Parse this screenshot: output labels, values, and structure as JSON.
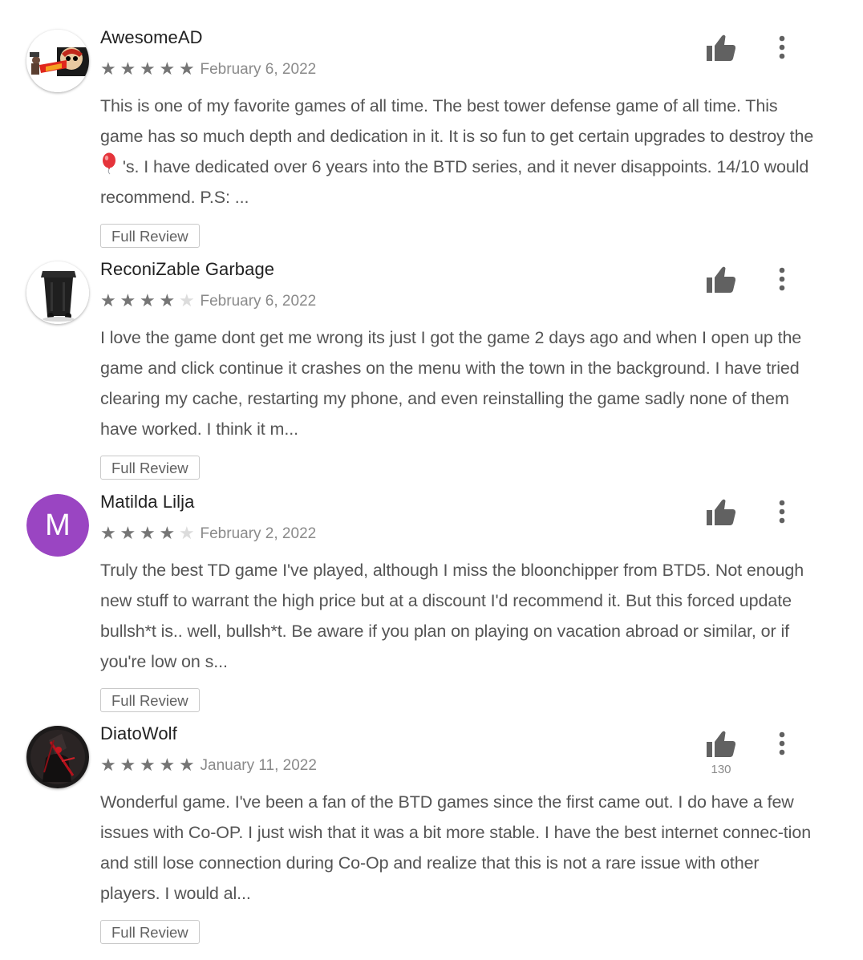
{
  "reviews": [
    {
      "author": "AwesomeAD",
      "rating": 5,
      "date": "February 6, 2022",
      "text_before": "This is one of my favorite games of all time. The best tower defense game of all time. This game has so much depth and dedication in it. It is so fun to get certain upgrades to destroy the ",
      "emoji": "balloon",
      "text_after": " 's. I have dedicated over 6 years into the BTD series, and it never disappoints. 14/10 would recommend. P.S: ...",
      "full_review_label": "Full Review",
      "avatar_icon": "cartoon-character-avatar"
    },
    {
      "author": "ReconiZable Garbage",
      "rating": 4,
      "date": "February 6, 2022",
      "text": "I love the game dont get me wrong its just I got the game 2 days ago and when I open up the game and click continue it crashes on the menu with the town in the background. I have tried clearing my cache, restarting my phone, and even reinstalling the game sadly none of them have worked. I think it m...",
      "full_review_label": "Full Review",
      "avatar_icon": "garbage-bin-avatar"
    },
    {
      "author": "Matilda Lilja",
      "rating": 4,
      "date": "February 2, 2022",
      "text": "Truly the best TD game I've played, although I miss the bloonchipper from BTD5. Not enough new stuff to warrant the high price but at a discount I'd recommend it. But this forced update bullsh*t is.. well, bullsh*t. Be aware if you plan on playing on vacation abroad or similar, or if you're low on s...",
      "full_review_label": "Full Review",
      "avatar_letter": "M",
      "avatar_color": "#9a45c2"
    },
    {
      "author": "DiatoWolf",
      "rating": 5,
      "date": "January 11, 2022",
      "helpful_count": "130",
      "text": "Wonderful game. I've been a fan of the BTD games since the first came out. I do have a few issues with Co-OP. I just wish that it was a bit more stable. I have the best internet connec-tion and still lose connection during Co-Op and realize that this is not a rare issue with other players. I would al...",
      "full_review_label": "Full Review",
      "avatar_icon": "dark-warrior-avatar"
    }
  ],
  "colors": {
    "star_on": "#757575",
    "star_off": "#dcdcdc",
    "icon": "#616161",
    "text": "#555555"
  }
}
